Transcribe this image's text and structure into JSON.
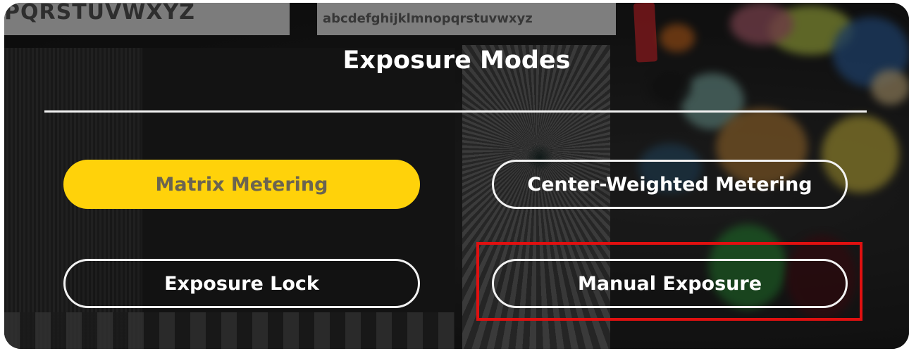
{
  "background": {
    "chart_text_upper": "PQRSTUVWXYZ",
    "chart_text_lower": "abcdefghijklmnopqrstuvwxyz"
  },
  "menu": {
    "title": "Exposure Modes",
    "options": [
      {
        "label": "Matrix Metering",
        "active": true
      },
      {
        "label": "Center-Weighted Metering",
        "active": false
      },
      {
        "label": "Exposure Lock",
        "active": false
      },
      {
        "label": "Manual Exposure",
        "active": false,
        "highlighted": true
      }
    ]
  },
  "colors": {
    "active_fill": "#ffd20a",
    "active_text": "#6b6450",
    "outline": "#f2f2f2",
    "highlight_box": "#e01010"
  }
}
